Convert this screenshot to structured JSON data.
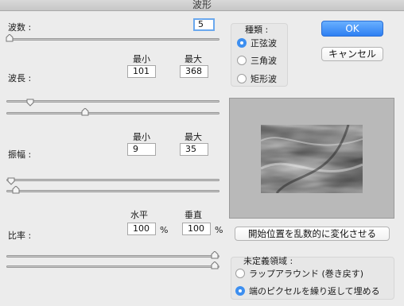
{
  "window": {
    "title": "波形"
  },
  "generators": {
    "label": "波数 :",
    "value": "5"
  },
  "wavelength": {
    "label": "波長 :",
    "min_header": "最小",
    "max_header": "最大",
    "min_value": "101",
    "max_value": "368"
  },
  "amplitude": {
    "label": "振幅 :",
    "min_header": "最小",
    "max_header": "最大",
    "min_value": "9",
    "max_value": "35"
  },
  "scale": {
    "label": "比率 :",
    "h_header": "水平",
    "v_header": "垂直",
    "h_value": "100",
    "v_value": "100",
    "unit": "%"
  },
  "type": {
    "title": "種類 :",
    "options": [
      {
        "label": "正弦波",
        "selected": true
      },
      {
        "label": "三角波",
        "selected": false
      },
      {
        "label": "矩形波",
        "selected": false
      }
    ]
  },
  "buttons": {
    "ok": "OK",
    "cancel": "キャンセル",
    "randomize": "開始位置を乱数的に変化させる"
  },
  "undefined_areas": {
    "title": "未定義領域 :",
    "options": [
      {
        "label": "ラップアラウンド (巻き戻す)",
        "selected": false
      },
      {
        "label": "端のピクセルを繰り返して埋める",
        "selected": true
      }
    ]
  },
  "colors": {
    "accent": "#3d8ff0",
    "ok_button": "#2e7ff2"
  }
}
